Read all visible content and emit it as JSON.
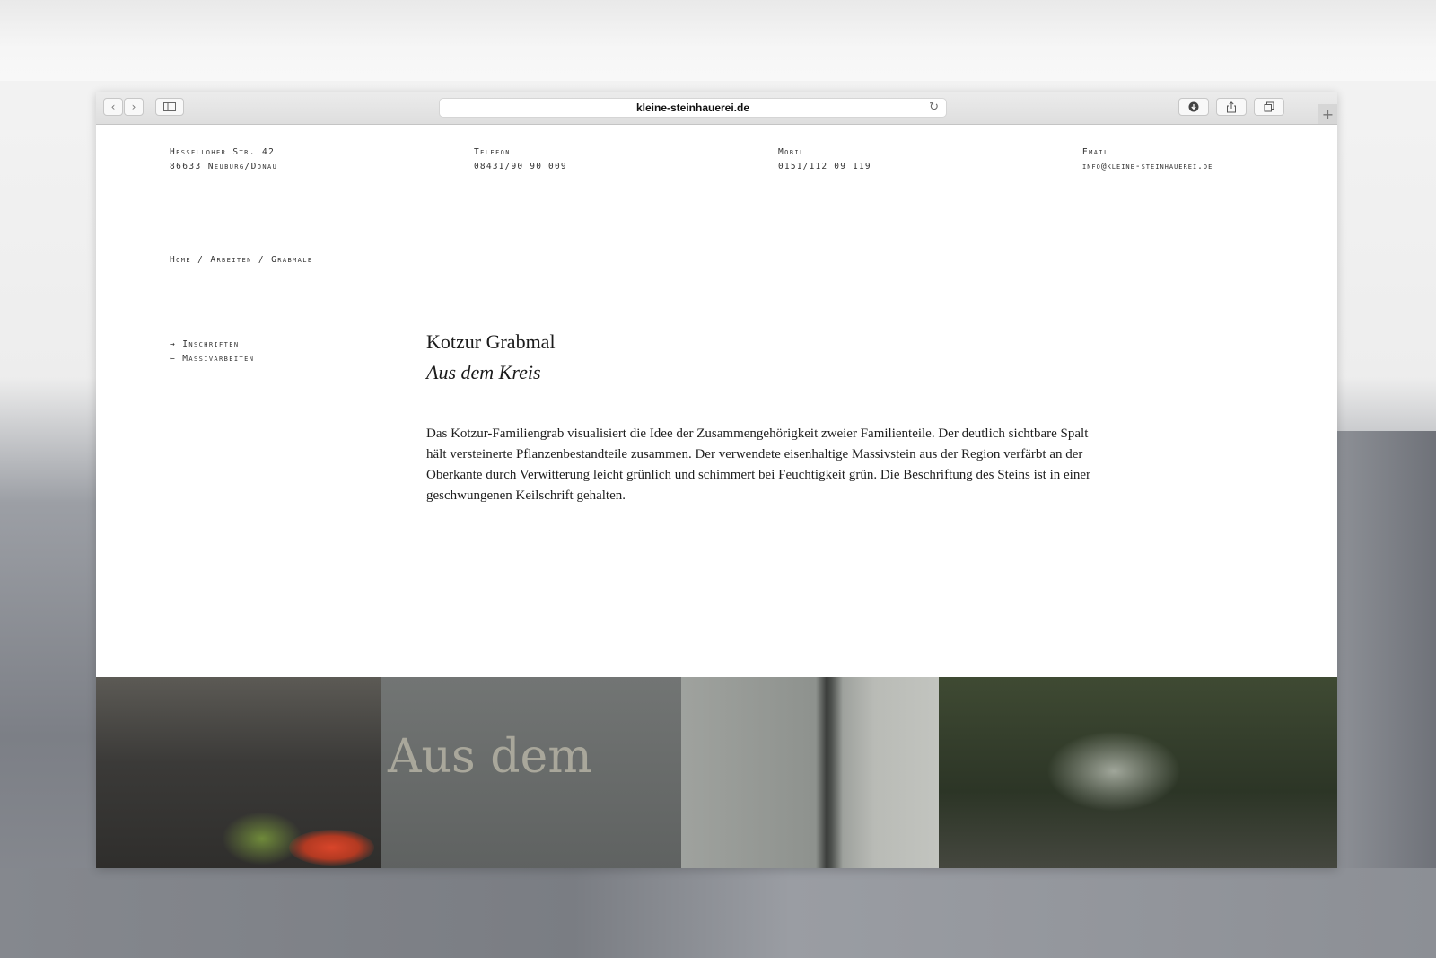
{
  "browser": {
    "url": "kleine-steinhauerei.de"
  },
  "contacts": {
    "address": {
      "line1": "Hesselloher Str. 42",
      "line2": "86633 Neuburg/Donau"
    },
    "telefon": {
      "label": "Telefon",
      "value": "08431/90 90 009"
    },
    "mobil": {
      "label": "Mobil",
      "value": "0151/112 09 119"
    },
    "email": {
      "label": "Email",
      "value": "info@kleine-steinhauerei.de"
    }
  },
  "breadcrumb": "Home / Arbeiten / Grabmale",
  "sidenav": {
    "next": "→ Inschriften",
    "prev": "← Massivarbeiten"
  },
  "article": {
    "title": "Kotzur Grabmal",
    "subtitle": "Aus dem Kreis",
    "body": "Das Kotzur-Familiengrab visualisiert die Idee der Zusammengehörigkeit zweier Familienteile. Der deutlich sichtbare Spalt hält versteinerte Pflanzenbestandteile zusammen. Der verwendete eisenhaltige Massivstein aus der Region verfärbt an der Oberkante durch Verwitterung leicht grünlich und schimmert bei Feuchtigkeit grün. Die Beschriftung des Steins ist in einer geschwungenen Keilschrift gehalten."
  },
  "photo": {
    "engraving": "Aus dem"
  }
}
